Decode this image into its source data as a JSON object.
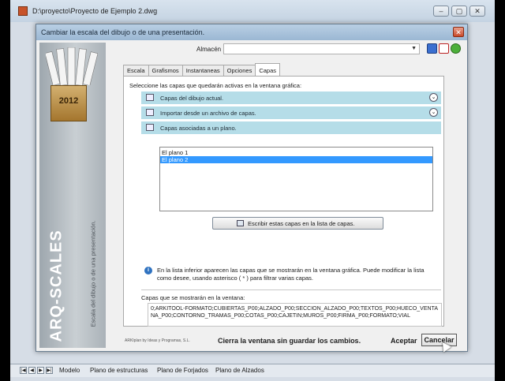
{
  "window": {
    "title": "D:\\proyecto\\Proyecto de Ejemplo 2.dwg",
    "buttons": [
      "–",
      "▢",
      "✕"
    ]
  },
  "dialog": {
    "title": "Cambiar la escala del dibujo o de una presentación.",
    "close_label": "✕",
    "sidebar": {
      "year": "2012",
      "product": "ARQ-SCALES",
      "subtitle": "Escala del dibujo o de una presentación."
    },
    "almacen": {
      "label": "Almacén",
      "value": "",
      "arrow": "▼"
    },
    "tabs": [
      "Escala",
      "Grafismos",
      "Instantaneas",
      "Opciones",
      "Capas"
    ],
    "selected_tab": "Capas",
    "capas": {
      "instruction": "Seleccione las capas que quedarán activas en la ventana gráfica:",
      "sections": [
        {
          "label": "Capas del dibujo actual.",
          "chevron": "⌄"
        },
        {
          "label": "Importar desde un archivo de capas.",
          "chevron": "⌄"
        },
        {
          "label": "Capas asociadas a un plano.",
          "chevron": ""
        }
      ],
      "planos": [
        "El plano 1",
        "El plano 2"
      ],
      "selected_plano": "El plano 2",
      "write_button": "Escribir estas capas en la lista de capas.",
      "info_icon": "i",
      "info": "En la lista inferior aparecen las capas que se mostrarán en la ventana gráfica. Puede modificar la lista como desee, usando asterisco ( * ) para filtrar varias capas.",
      "layers_label": "Capas que se mostrarán en la ventana:",
      "layers_value": "0;ARKITOOL-FORMATO;CUBIERTAS_P00;ALZADO_P00;SECCION_ALZADO_P00;TEXTOS_P00;HUECO_VENTANA_P00;CONTORNO_TRAMAS_P00;COTAS_P00;CAJETIN;MUROS_P00;FIRMA_P00;FORMATO;VIAL"
    },
    "footer": {
      "credit": "ARKIplan by Ideas y Programas, S.L.",
      "status": "Cierra la ventana sin guardar los cambios.",
      "accept": "Aceptar",
      "cancel": "Cancelar"
    }
  },
  "layout_tabs": {
    "nav": [
      "|◀",
      "◀",
      "▶",
      "▶|"
    ],
    "sheets": [
      "Modelo",
      "Plano de estructuras",
      "Plano de Forjados",
      "Plano de Alzados"
    ]
  },
  "colors": {
    "accordion": "#b5dde8",
    "selection": "#3399ff",
    "sidebar": "#b3bbc1",
    "box": "#c49a52"
  }
}
